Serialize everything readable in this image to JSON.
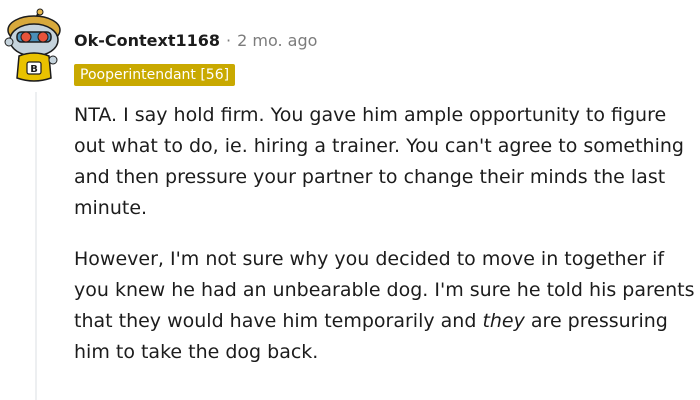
{
  "comment": {
    "username": "Ok-Context1168",
    "separator": "·",
    "timestamp": "2 mo. ago",
    "flair": "Pooperintendant [56]",
    "paragraph1": "NTA. I say hold firm. You gave him ample opportunity to figure out what to do, ie. hiring a trainer. You can't agree to something and then pressure your partner to change their minds the last minute.",
    "paragraph2_before": "However, I'm not sure why you decided to move in together if you knew he had an unbearable dog. I'm sure he told his parents that they would have him temporarily and ",
    "paragraph2_emphasis": "they",
    "paragraph2_after": " are pressuring him to take the dog back.",
    "avatar_icon": "snoo-avatar-icon",
    "flair_color": "#c9a900"
  }
}
